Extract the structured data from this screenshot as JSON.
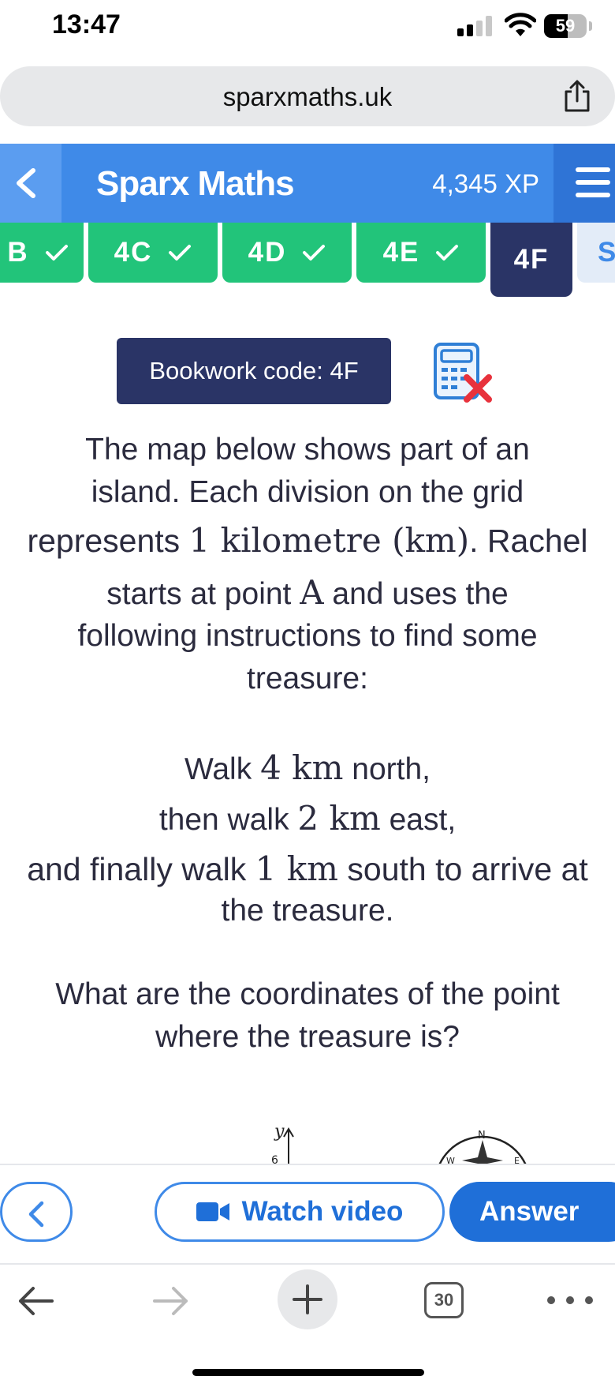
{
  "status_bar": {
    "time": "13:47",
    "battery": "59"
  },
  "browser": {
    "url": "sparxmaths.uk",
    "tabs_count": "30"
  },
  "header": {
    "title": "Sparx Maths",
    "xp": "4,345 XP"
  },
  "tabs": [
    {
      "label": "B",
      "completed": true
    },
    {
      "label": "4C",
      "completed": true
    },
    {
      "label": "4D",
      "completed": true
    },
    {
      "label": "4E",
      "completed": true
    },
    {
      "label": "4F",
      "completed": false,
      "active": true
    },
    {
      "label": "S",
      "completed": false
    }
  ],
  "bookwork": {
    "label": "Bookwork code: 4F"
  },
  "question": {
    "intro_1": "The map below shows part of an",
    "intro_2": "island. Each division on the grid",
    "intro_3a": "represents ",
    "intro_3b": "1 kilometre (km)",
    "intro_3c": ". Rachel",
    "intro_4a": "starts at point ",
    "intro_4b": "A",
    "intro_4c": " and uses the",
    "intro_5": "following instructions to find some",
    "intro_6": "treasure:",
    "step_1a": "Walk ",
    "step_1b": "4 km",
    "step_1c": " north,",
    "step_2a": "then walk ",
    "step_2b": "2 km",
    "step_2c": " east,",
    "step_3a": "and finally walk ",
    "step_3b": "1 km",
    "step_3c": " south to arrive at",
    "step_4": "the treasure.",
    "ask_1": "What are the coordinates of the point",
    "ask_2": "where the treasure is?"
  },
  "diagram": {
    "axis_label": "y",
    "tick": "6",
    "compass_n": "N",
    "compass_w": "W",
    "compass_e": "E"
  },
  "actions": {
    "watch_video": "Watch video",
    "answer": "Answer"
  },
  "colors": {
    "brand_blue": "#3f8ae8",
    "complete_green": "#22c47a",
    "navy": "#2a3466",
    "action_blue": "#1f6fd8",
    "error_red": "#e8323c"
  }
}
